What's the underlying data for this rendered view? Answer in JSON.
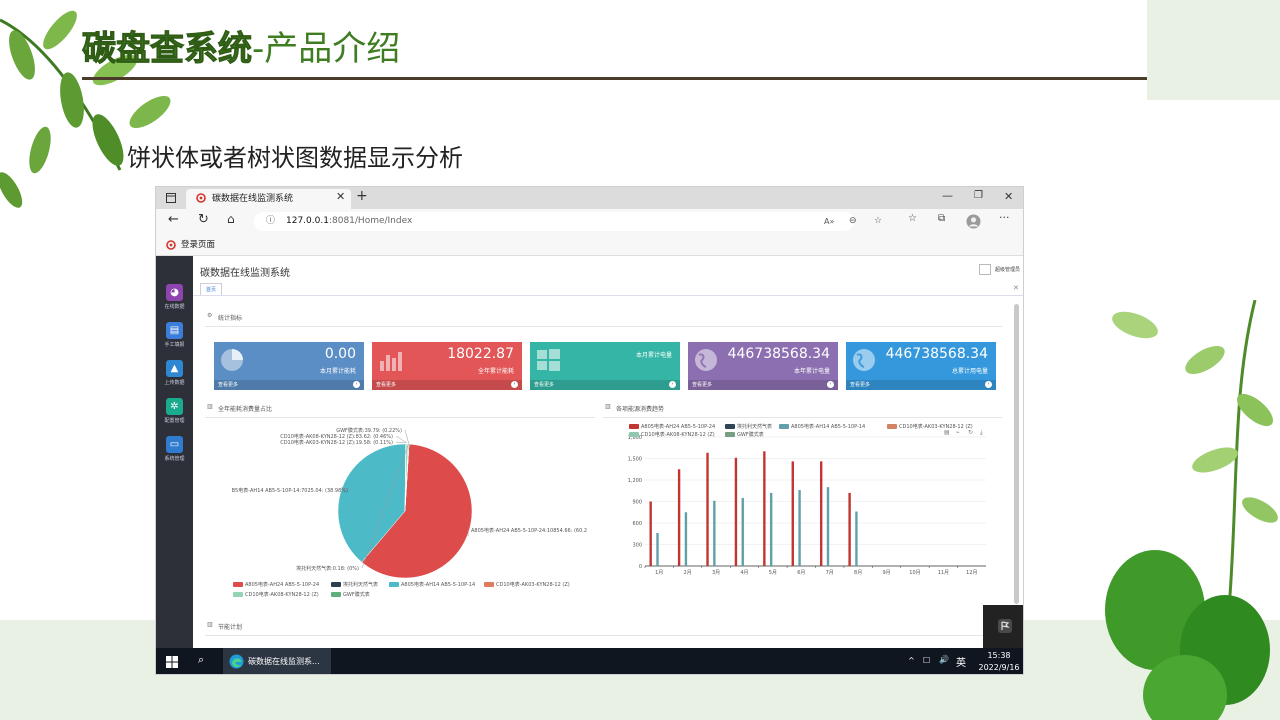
{
  "slide": {
    "title_strong": "碳盘查系统",
    "title_rest": "-产品介绍",
    "subtitle": "饼状体或者树状图数据显示分析"
  },
  "browser": {
    "tab_title": "碳数据在线监测系统",
    "address_host": "127.0.0.1",
    "address_path": ":8081/Home/Index",
    "favorite": "登录页面"
  },
  "app": {
    "title": "碳数据在线监测系统",
    "top_right": "超级管理员",
    "home_tab": "首页",
    "section_stats": "统计指标",
    "section_pie": "全年能耗消费量占比",
    "section_bar": "各项能源消费趋势",
    "section_plan": "节能计划"
  },
  "sidebar": {
    "items": [
      {
        "label": "在线数据",
        "color": "#8e44ad"
      },
      {
        "label": "手工填报",
        "color": "#3b7dd8"
      },
      {
        "label": "上传数据",
        "color": "#2f86d1"
      },
      {
        "label": "配置管理",
        "color": "#1aaa8e"
      },
      {
        "label": "系统管理",
        "color": "#2e7bd0"
      }
    ]
  },
  "stats": [
    {
      "value": "0.00",
      "label": "本月累计能耗",
      "footer": "查看更多",
      "color": "#5b8ec4"
    },
    {
      "value": "18022.87",
      "label": "全年累计能耗",
      "footer": "查看更多",
      "color": "#e25658"
    },
    {
      "value": "",
      "label": "本月累计电量",
      "footer": "查看更多",
      "color": "#35b5a5"
    },
    {
      "value": "446738568.34",
      "label": "本年累计电量",
      "footer": "查看更多",
      "color": "#8c6fb0"
    },
    {
      "value": "446738568.34",
      "label": "总累计用电量",
      "footer": "查看更多",
      "color": "#3598dc"
    }
  ],
  "taskbar": {
    "app_label": "碳数据在线监测系...",
    "ime": "英",
    "time": "15:38",
    "date": "2022/9/16"
  },
  "chart_data": [
    {
      "type": "pie",
      "slices": [
        {
          "label": "A805电表-AH24 AB5-5-10P-24:10854.66: (60.2",
          "value": 10854.66,
          "color": "#dd4b4b"
        },
        {
          "label": "B5电表-AH14 AB5-5-10P-14:7025.04: (38.98%)",
          "value": 7025.04,
          "color": "#4dbac8"
        },
        {
          "label": "CD10电表-AK03-KYN28-12 (Z):19.58: (0.11%)",
          "value": 19.58,
          "color": "#e07b5e"
        },
        {
          "label": "CD10电表-AK08-KYN28-12 (Z):83.62: (0.46%)",
          "value": 83.62,
          "color": "#92d4b4"
        },
        {
          "label": "GWF膜式表:39.79: (0.22%)",
          "value": 39.79,
          "color": "#5fb07b"
        },
        {
          "label": "埃托利天然气表:0.18: (0%)",
          "value": 0.18,
          "color": "#2c3e50"
        }
      ],
      "legend": [
        {
          "name": "A805电表-AH24 AB5-5-10P-24",
          "color": "#dd4b4b"
        },
        {
          "name": "埃托利天然气表",
          "color": "#2c3e50"
        },
        {
          "name": "A805电表-AH14 AB5-5-10P-14",
          "color": "#4dbac8"
        },
        {
          "name": "CD10电表-AK03-KYN28-12 (Z)",
          "color": "#e07b5e"
        },
        {
          "name": "CD10电表-AK08-KYN28-12 (Z)",
          "color": "#92d4b4"
        },
        {
          "name": "GWF膜式表",
          "color": "#5fb07b"
        }
      ],
      "legend_placement": "bottom"
    },
    {
      "type": "bar",
      "categories": [
        "1月",
        "2月",
        "3月",
        "4月",
        "5月",
        "6月",
        "7月",
        "8月",
        "9月",
        "10月",
        "11月",
        "12月"
      ],
      "series": [
        {
          "name": "A805电表-AH24 AB5-5-10P-24",
          "color": "#c23531",
          "values": [
            900,
            1350,
            1580,
            1510,
            1600,
            1460,
            1460,
            1020,
            0,
            0,
            0,
            0
          ]
        },
        {
          "name": "埃托利天然气表",
          "color": "#2f4554",
          "values": [
            0,
            0,
            0,
            0,
            0,
            0,
            0,
            0,
            0,
            0,
            0,
            0
          ]
        },
        {
          "name": "A805电表-AH14 AB5-5-10P-14",
          "color": "#61a0a8",
          "values": [
            460,
            750,
            910,
            950,
            1020,
            1060,
            1100,
            760,
            0,
            0,
            0,
            0
          ]
        },
        {
          "name": "CD10电表-AK03-KYN28-12 (Z)",
          "color": "#d48265",
          "values": [
            0,
            0,
            0,
            0,
            0,
            0,
            0,
            0,
            0,
            0,
            0,
            0
          ]
        },
        {
          "name": "CD10电表-AK08-KYN28-12 (Z)",
          "color": "#91c7ae",
          "values": [
            0,
            0,
            0,
            0,
            0,
            0,
            0,
            0,
            0,
            0,
            0,
            0
          ]
        },
        {
          "name": "GWF膜式表",
          "color": "#749f83",
          "values": [
            0,
            0,
            0,
            0,
            0,
            0,
            0,
            0,
            0,
            0,
            0,
            0
          ]
        }
      ],
      "ylim": [
        0,
        1800
      ],
      "yticks": [
        "0",
        "300",
        "600",
        "900",
        "1,200",
        "1,500",
        "1,800"
      ],
      "grid": true,
      "legend_placement": "top"
    }
  ]
}
